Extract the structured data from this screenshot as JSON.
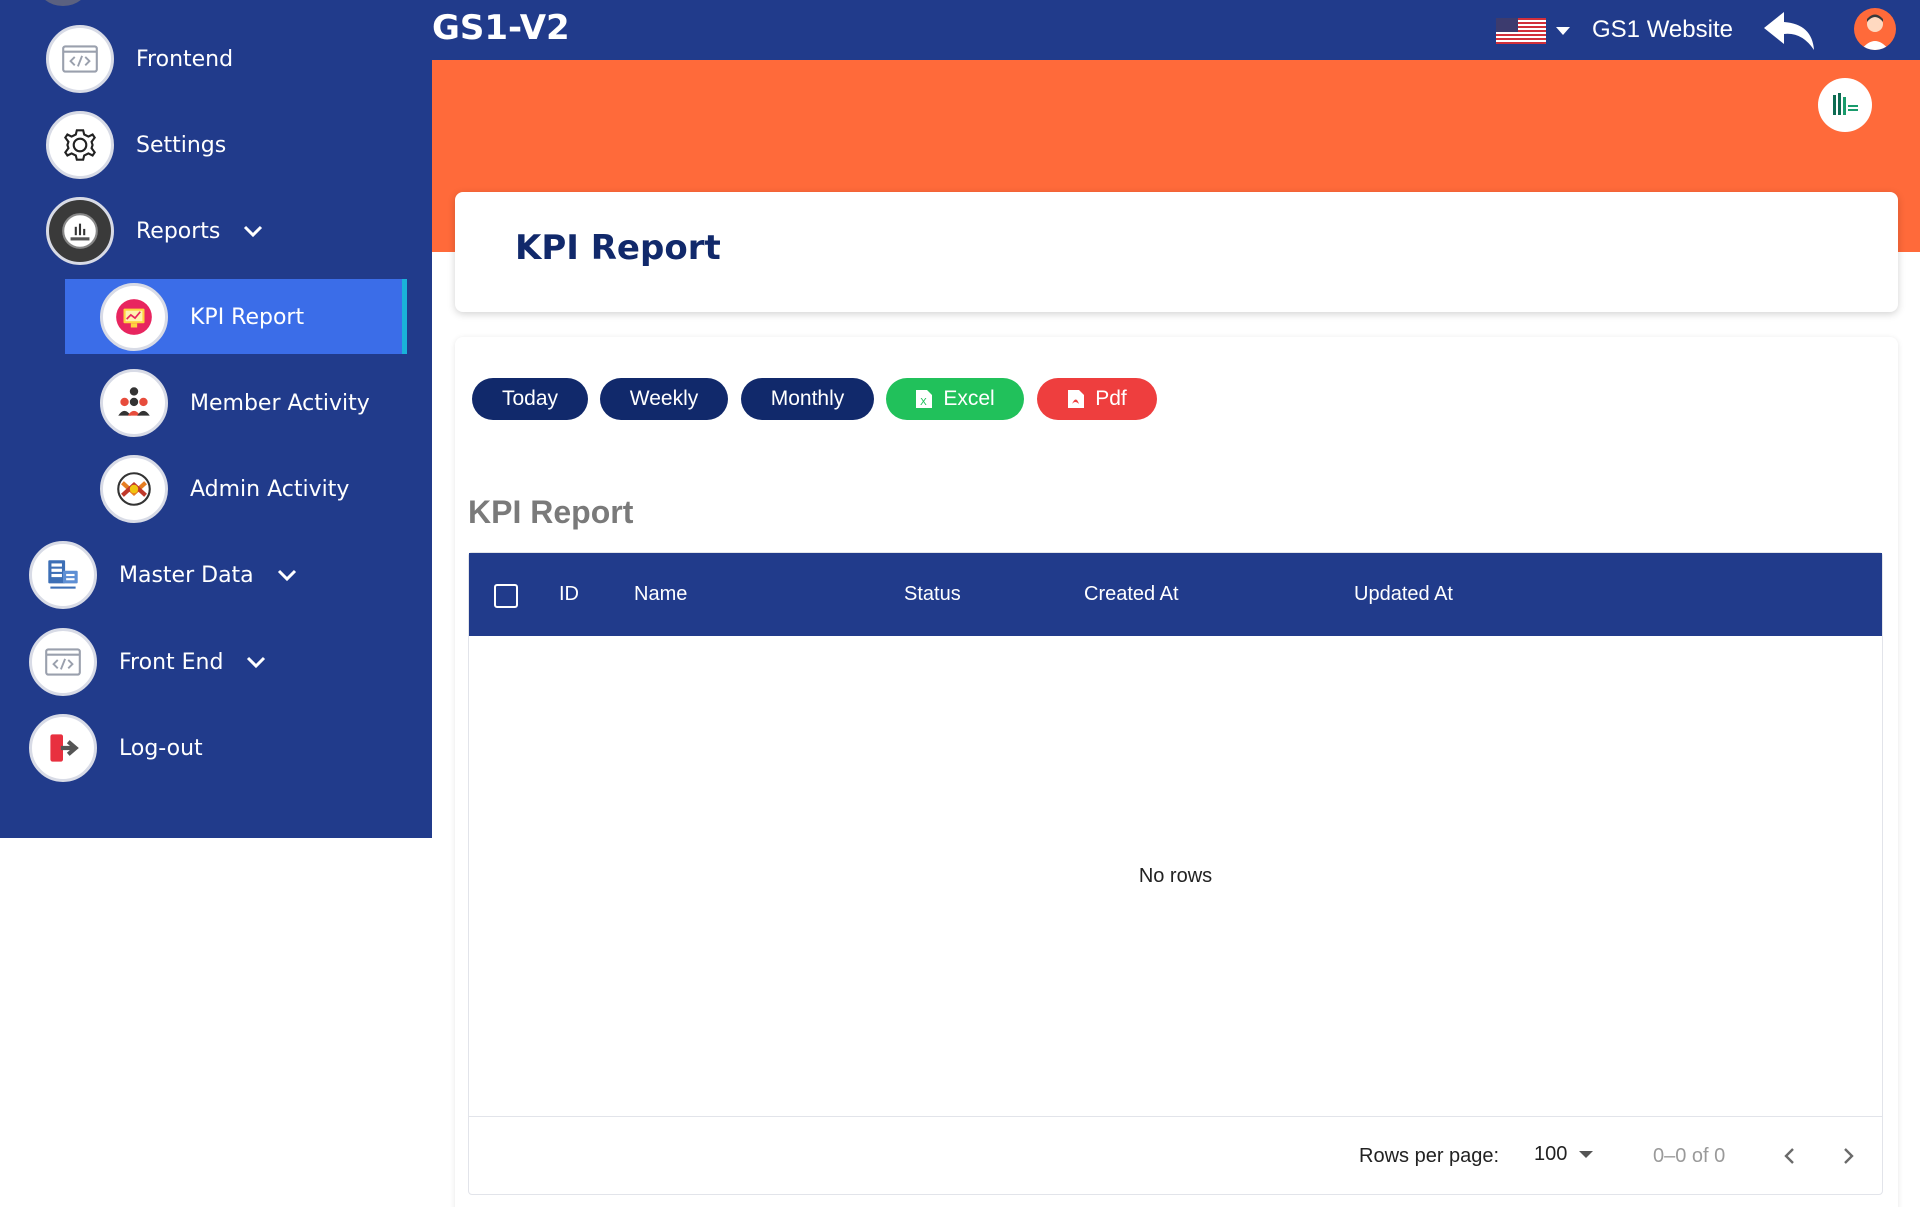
{
  "app": {
    "title": "GS1-V2"
  },
  "header": {
    "language_icon": "us-flag-icon",
    "website_link": "GS1 Website",
    "back_icon": "reply-arrow-icon",
    "avatar_icon": "user-avatar-icon"
  },
  "colors": {
    "sidebar": "#213b8b",
    "banner": "#ff6a3a",
    "active_item": "#3b6de8",
    "dark_button": "#11296b",
    "excel": "#21c15b",
    "pdf": "#ee3e3e"
  },
  "sidebar": {
    "items": [
      {
        "label": "Frontend",
        "icon": "code-window-icon"
      },
      {
        "label": "Settings",
        "icon": "gear-icon"
      },
      {
        "label": "Reports",
        "icon": "report-chart-icon",
        "expanded": true
      },
      {
        "label": "KPI Report",
        "icon": "kpi-monitor-icon",
        "active": true
      },
      {
        "label": "Member Activity",
        "icon": "team-icon"
      },
      {
        "label": "Admin Activity",
        "icon": "handshake-icon"
      },
      {
        "label": "Master Data",
        "icon": "master-data-icon"
      },
      {
        "label": "Front End",
        "icon": "code-window-icon"
      },
      {
        "label": "Log-out",
        "icon": "logout-door-icon"
      }
    ]
  },
  "page": {
    "title": "KPI Report"
  },
  "filters": {
    "today": "Today",
    "weekly": "Weekly",
    "monthly": "Monthly",
    "excel": "Excel",
    "pdf": "Pdf"
  },
  "table": {
    "title": "KPI Report",
    "columns": [
      "ID",
      "Name",
      "Status",
      "Created At",
      "Updated At"
    ],
    "rows": [],
    "empty_text": "No rows",
    "footer": {
      "rows_per_page_label": "Rows per page:",
      "rows_per_page": "100",
      "range": "0–0 of 0"
    }
  }
}
